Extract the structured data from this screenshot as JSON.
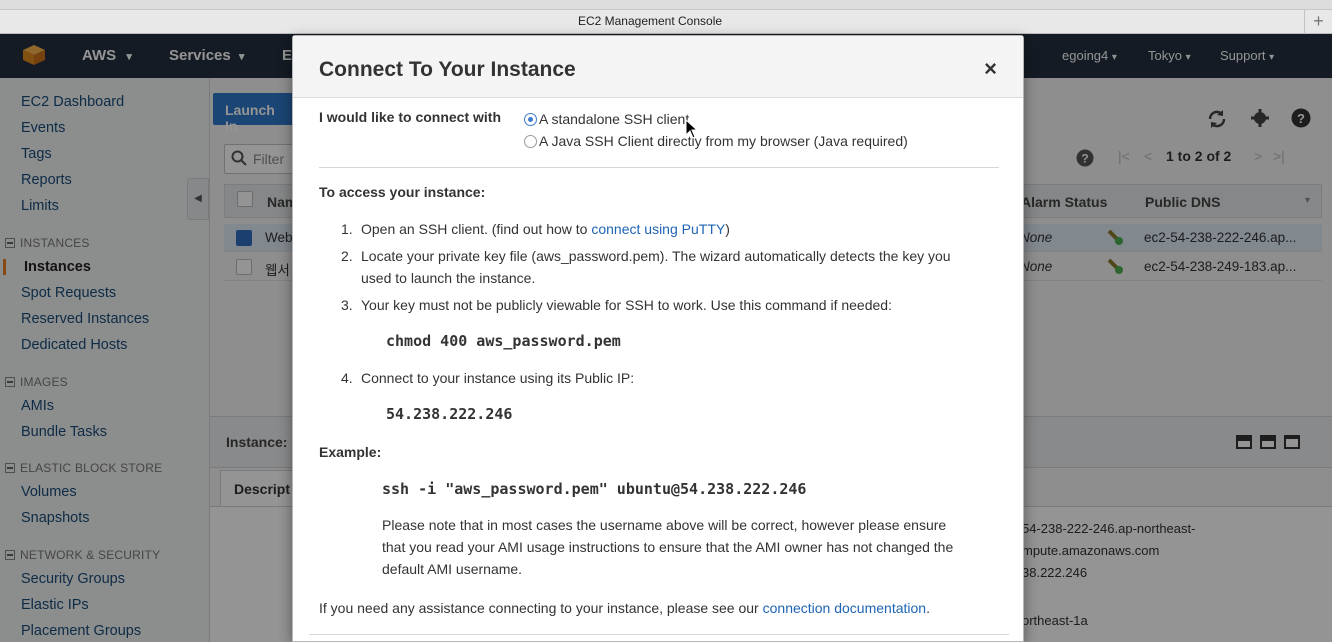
{
  "browser": {
    "tab_title": "EC2 Management Console",
    "new_tab": "+"
  },
  "nav": {
    "brand": "AWS",
    "services": "Services",
    "services_trunc": "E",
    "user": "egoing4",
    "region": "Tokyo",
    "support": "Support",
    "caret": "▾"
  },
  "sidebar": {
    "top_items": [
      "EC2 Dashboard",
      "Events",
      "Tags",
      "Reports",
      "Limits"
    ],
    "instances_section": "INSTANCES",
    "instances_items": [
      "Instances",
      "Spot Requests",
      "Reserved Instances",
      "Dedicated Hosts"
    ],
    "images_section": "IMAGES",
    "images_items": [
      "AMIs",
      "Bundle Tasks"
    ],
    "ebs_section": "ELASTIC BLOCK STORE",
    "ebs_items": [
      "Volumes",
      "Snapshots"
    ],
    "network_section": "NETWORK & SECURITY",
    "network_items": [
      "Security Groups",
      "Elastic IPs",
      "Placement Groups"
    ]
  },
  "main": {
    "launch_button": "Launch In",
    "filter_placeholder": "Filter",
    "pager_text": "1 to 2 of 2",
    "columns": {
      "name": "Nam",
      "alarm": "Alarm Status",
      "dns": "Public DNS"
    },
    "rows": [
      {
        "name": "Web",
        "alarm": "None",
        "dns": "ec2-54-238-222-246.ap..."
      },
      {
        "name": "웹서",
        "alarm": "None",
        "dns": "ec2-54-238-249-183.ap..."
      }
    ],
    "instance_label": "Instance:",
    "description_tab": "Descript",
    "detail_lines": [
      "54-238-222-246.ap-northeast-",
      "mpute.amazonaws.com",
      "38.222.246",
      "ortheast-1a"
    ]
  },
  "modal": {
    "title": "Connect To Your Instance",
    "close": "×",
    "connect_with_label": "I would like to connect with",
    "option_ssh": "A standalone SSH client",
    "option_java": "A Java SSH Client directly from my browser (Java required)",
    "access_heading": "To access your instance:",
    "step1_text": "Open an SSH client. (find out how to",
    "step1_link": "connect using PuTTY",
    "step1_end": ")",
    "step2_line1": "Locate your private key file (aws_password.pem). The wizard automatically detects the key you",
    "step2_line2": "used to launch the instance.",
    "step3_text": "Your key must not be publicly viewable for SSH to work. Use this command if needed:",
    "chmod_cmd": "chmod 400 aws_password.pem",
    "step4_text": "Connect to your instance using its Public IP:",
    "public_ip": "54.238.222.246",
    "example_heading": "Example:",
    "ssh_cmd": "ssh -i \"aws_password.pem\" ubuntu@54.238.222.246",
    "note_line1": "Please note that in most cases the username above will be correct, however please ensure",
    "note_line2": "that you read your AMI usage instructions to ensure that the AMI owner has not changed the",
    "note_line3": "default AMI username.",
    "help_text": "If you need any assistance connecting to your instance, please see our",
    "help_link": "connection documentation",
    "help_end": ".",
    "step_numbers": [
      "1.",
      "2.",
      "3.",
      "4."
    ]
  }
}
